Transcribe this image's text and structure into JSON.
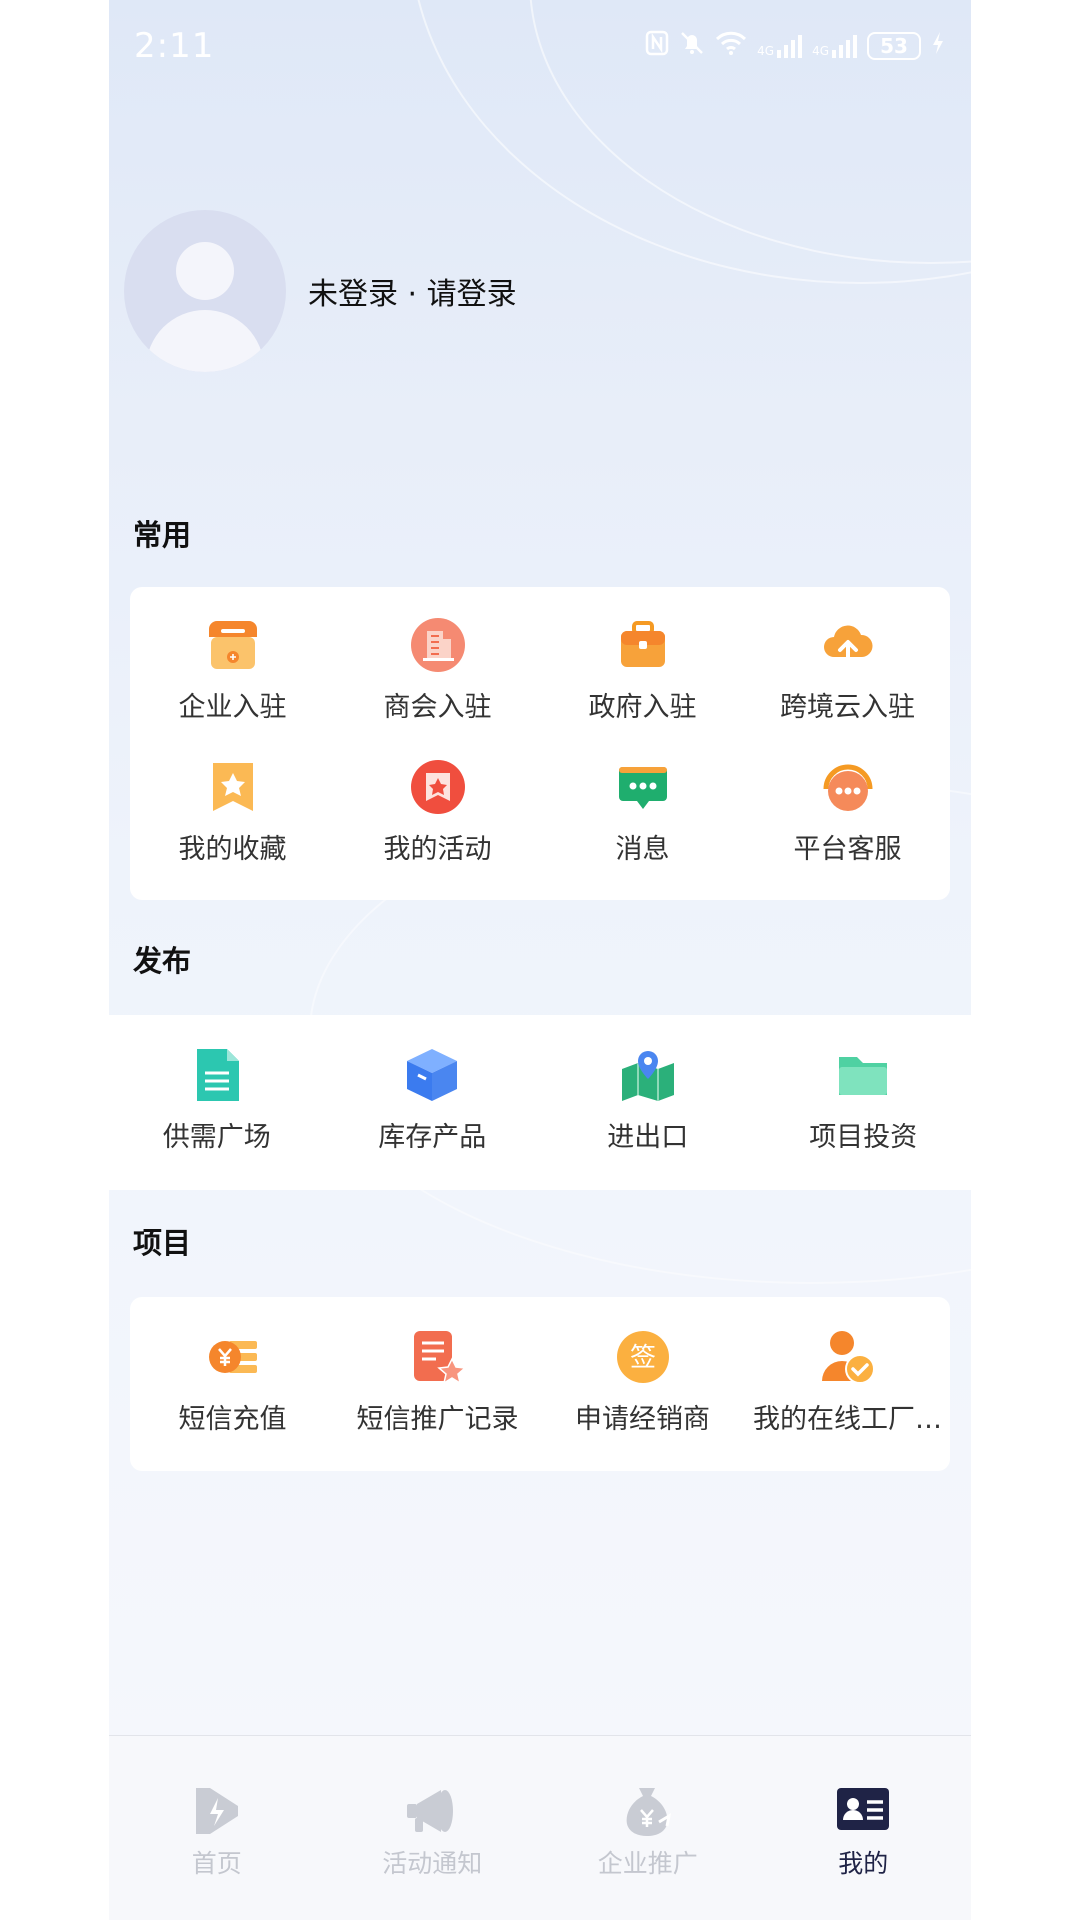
{
  "status_bar": {
    "time": "2:11",
    "battery": "53",
    "net1": "4G",
    "net2": "4G"
  },
  "profile": {
    "login_text": "未登录 · 请登录"
  },
  "sections": {
    "common": {
      "title": "常用",
      "items": [
        {
          "label": "企业入驻",
          "icon": "store-icon"
        },
        {
          "label": "商会入驻",
          "icon": "building-icon"
        },
        {
          "label": "政府入驻",
          "icon": "briefcase-icon"
        },
        {
          "label": "跨境云入驻",
          "icon": "cloud-upload-icon"
        },
        {
          "label": "我的收藏",
          "icon": "star-bookmark-icon"
        },
        {
          "label": "我的活动",
          "icon": "activity-icon"
        },
        {
          "label": "消息",
          "icon": "message-icon"
        },
        {
          "label": "平台客服",
          "icon": "headset-icon"
        }
      ]
    },
    "publish": {
      "title": "发布",
      "items": [
        {
          "label": "供需广场",
          "icon": "document-icon"
        },
        {
          "label": "库存产品",
          "icon": "box-icon"
        },
        {
          "label": "进出口",
          "icon": "map-pin-icon"
        },
        {
          "label": "项目投资",
          "icon": "folder-icon"
        }
      ]
    },
    "project": {
      "title": "项目",
      "items": [
        {
          "label": "短信充值",
          "icon": "coin-recharge-icon"
        },
        {
          "label": "短信推广记录",
          "icon": "record-icon"
        },
        {
          "label": "申请经销商",
          "icon": "sign-icon"
        },
        {
          "label": "我的在线工厂…",
          "icon": "user-check-icon"
        }
      ]
    }
  },
  "tabbar": {
    "items": [
      {
        "label": "首页",
        "icon": "home-play-icon",
        "active": false
      },
      {
        "label": "活动通知",
        "icon": "megaphone-icon",
        "active": false
      },
      {
        "label": "企业推广",
        "icon": "money-bag-icon",
        "active": false
      },
      {
        "label": "我的",
        "icon": "id-card-icon",
        "active": true
      }
    ]
  },
  "colors": {
    "accent_orange": "#f59a23",
    "accent_red": "#f26d4f",
    "accent_green": "#1fae6e",
    "accent_teal": "#2cc7b0",
    "accent_blue": "#4a86f0",
    "tab_active": "#1f2346",
    "tab_inactive": "#c4c7cf"
  }
}
